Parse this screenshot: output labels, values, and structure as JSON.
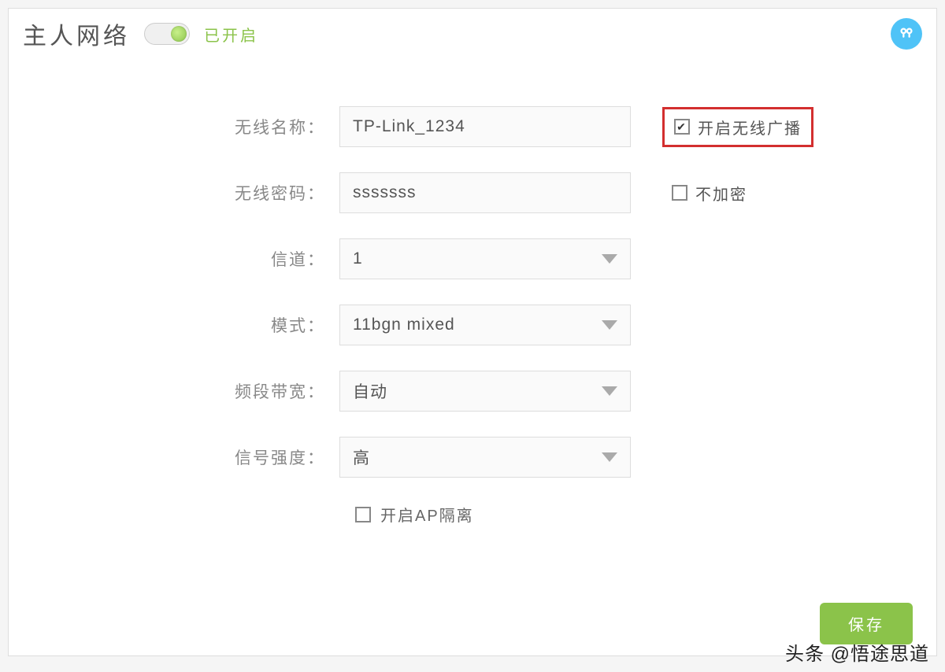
{
  "header": {
    "title": "主人网络",
    "status": "已开启",
    "help": "?"
  },
  "form": {
    "ssid": {
      "label": "无线名称：",
      "value": "TP-Link_1234"
    },
    "broadcast": {
      "label": "开启无线广播",
      "checked": true
    },
    "password": {
      "label": "无线密码：",
      "value": "sssssss"
    },
    "noencrypt": {
      "label": "不加密",
      "checked": false
    },
    "channel": {
      "label": "信道：",
      "value": "1"
    },
    "mode": {
      "label": "模式：",
      "value": "11bgn mixed"
    },
    "bandwidth": {
      "label": "频段带宽：",
      "value": "自动"
    },
    "signal": {
      "label": "信号强度：",
      "value": "高"
    },
    "ap_isolation": {
      "label": "开启AP隔离",
      "checked": false
    }
  },
  "buttons": {
    "save": "保存"
  },
  "watermark": "头条 @悟途思道"
}
